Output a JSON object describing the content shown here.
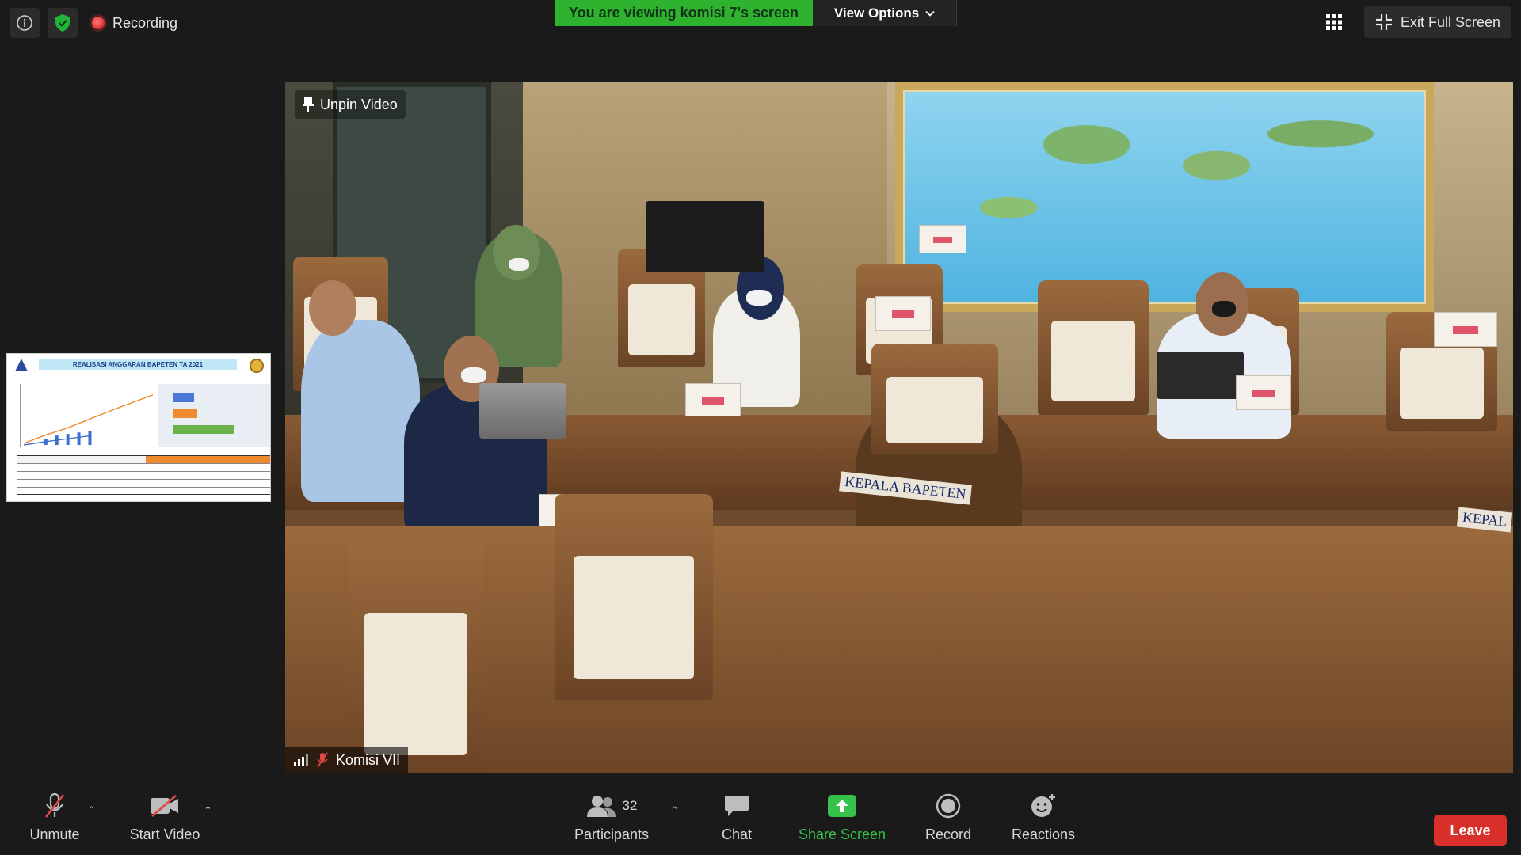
{
  "topbar": {
    "recording_label": "Recording",
    "viewing_banner": "You are viewing komisi 7's screen",
    "view_options_label": "View Options",
    "exit_fullscreen_label": "Exit Full Screen"
  },
  "thumbnail": {
    "title": "REALISASI ANGGARAN BAPETEN TA 2021"
  },
  "video": {
    "unpin_label": "Unpin Video",
    "participant_name": "Komisi VII",
    "table_label_1": "KEPALA BAPETEN",
    "table_label_2": "KEPAL"
  },
  "toolbar": {
    "unmute_label": "Unmute",
    "start_video_label": "Start Video",
    "participants_label": "Participants",
    "participants_count": "32",
    "chat_label": "Chat",
    "share_screen_label": "Share Screen",
    "record_label": "Record",
    "reactions_label": "Reactions",
    "leave_label": "Leave"
  },
  "colors": {
    "banner_green": "#2fb32f",
    "share_green": "#35c24a",
    "leave_red": "#d9302c",
    "background": "#1a1a1a"
  },
  "icons": [
    "info-icon",
    "shield-icon",
    "recording-dot-icon",
    "chevron-down-icon",
    "grid-icon",
    "exit-fullscreen-icon",
    "pin-icon",
    "signal-icon",
    "mic-muted-icon",
    "video-off-icon",
    "participants-icon",
    "chat-icon",
    "share-screen-icon",
    "record-icon",
    "reactions-icon"
  ]
}
